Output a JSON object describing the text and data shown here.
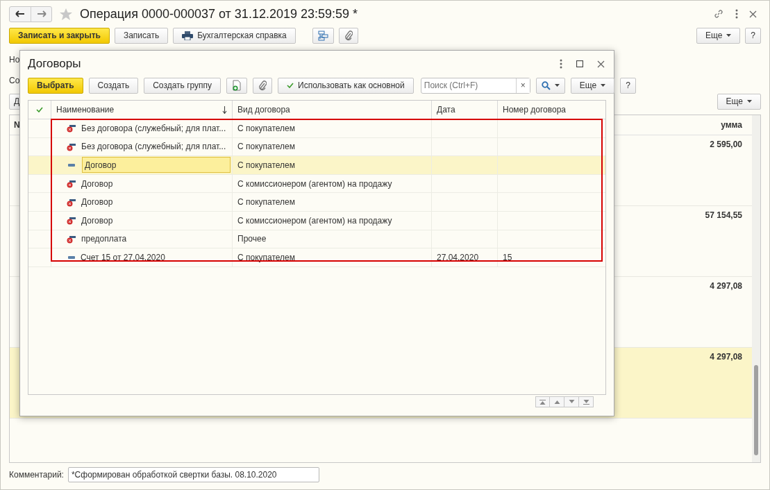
{
  "window": {
    "title": "Операция 0000-000037 от 31.12.2019 23:59:59 *",
    "favorite": false
  },
  "toolbar": {
    "buttons": [
      {
        "label": "Записать и закрыть",
        "kind": "primary"
      },
      {
        "label": "Записать",
        "kind": "plain"
      },
      {
        "label": "Бухгалтерская справка",
        "kind": "print"
      },
      {
        "kind": "structure"
      },
      {
        "kind": "attach"
      }
    ],
    "more": "Еще",
    "help": "?"
  },
  "form": {
    "label_1": "Но",
    "label_2": "Со",
    "button_1": "Д",
    "more": "Еще"
  },
  "table": {
    "columns": [
      "N",
      "умма"
    ],
    "rows": [
      {
        "amount": "2 595,00",
        "selected": false
      },
      {
        "amount": "57 154,55",
        "selected": false
      },
      {
        "amount": "4 297,08",
        "selected": false
      },
      {
        "amount": "4 297,08",
        "selected": true
      }
    ]
  },
  "comment": {
    "label": "Комментарий:",
    "value": "*Сформирован обработкой свертки базы. 08.10.2020"
  },
  "dialog": {
    "title": "Договоры",
    "toolbar": {
      "buttons": [
        {
          "label": "Выбрать",
          "kind": "primary"
        },
        {
          "label": "Создать",
          "kind": "plain"
        },
        {
          "label": "Создать группу",
          "kind": "plain"
        },
        {
          "kind": "add"
        },
        {
          "kind": "attach"
        },
        {
          "label": "Использовать как основной",
          "kind": "check"
        }
      ],
      "search": {
        "placeholder": "Поиск (Ctrl+F)",
        "clear": "×"
      },
      "more": "Еще",
      "help": "?"
    },
    "table": {
      "columns": [
        {
          "label": "Наименование",
          "sorted": true
        },
        {
          "label": "Вид договора",
          "sorted": false
        },
        {
          "label": "Дата",
          "sorted": false
        },
        {
          "label": "Номер договора",
          "sorted": false
        }
      ],
      "rows": [
        {
          "name": "Без договора (служебный; для плат...",
          "type": "С покупателем",
          "deleted": true,
          "selected": false
        },
        {
          "name": "Без договора (служебный; для плат...",
          "type": "С покупателем",
          "deleted": true,
          "selected": false
        },
        {
          "name": "Договор",
          "type": "С покупателем",
          "deleted": false,
          "selected": true
        },
        {
          "name": "Договор",
          "type": "С комиссионером (агентом) на продажу",
          "deleted": true,
          "selected": false
        },
        {
          "name": "Договор",
          "type": "С покупателем",
          "deleted": true,
          "selected": false
        },
        {
          "name": "Договор",
          "type": "С комиссионером (агентом) на продажу",
          "deleted": true,
          "selected": false
        },
        {
          "name": "предоплата",
          "type": "Прочее",
          "deleted": true,
          "selected": false
        },
        {
          "name": "Счет 15 от 27.04.2020",
          "type": "С покупателем",
          "date": "27.04.2020",
          "number": "15",
          "deleted": false,
          "selected": false
        }
      ]
    }
  }
}
